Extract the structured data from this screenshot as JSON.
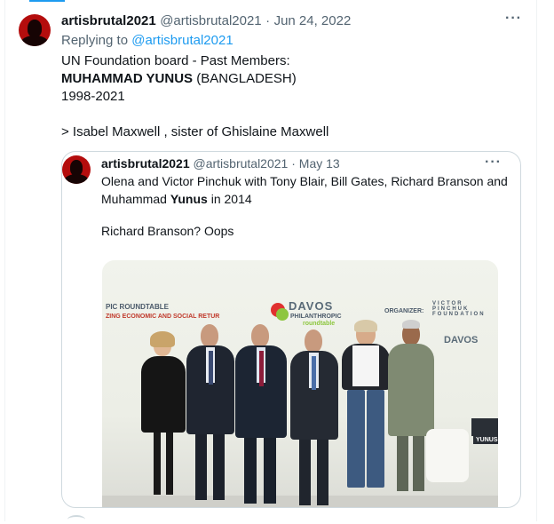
{
  "tweet": {
    "display_name": "artisbrutal2021",
    "handle": "@artisbrutal2021",
    "separator": "·",
    "date": "Jun 24, 2022",
    "replying_prefix": "Replying to",
    "replying_handle": "@artisbrutal2021",
    "more_icon": "more-horizontal-icon",
    "lines": {
      "line1": "UN Foundation board - Past Members:",
      "line2_bold": "MUHAMMAD YUNUS",
      "line2_rest": " (BANGLADESH)",
      "line3": "1998-2021",
      "line5": "> Isabel Maxwell , sister of Ghislaine Maxwell"
    }
  },
  "quote": {
    "display_name": "artisbrutal2021",
    "handle": "@artisbrutal2021",
    "separator": "·",
    "date": "May 13",
    "text_part1": "Olena and Victor Pinchuk with Tony Blair, Bill Gates, Richard Branson and Muhammad ",
    "text_bold": "Yunus",
    "text_part2": " in 2014",
    "text_line2": "Richard Branson? Oops",
    "photo": {
      "sign_left1": "PIC ROUNDTABLE",
      "sign_left2": "ZING ECONOMIC AND SOCIAL RETUR",
      "davos": "DAVOS",
      "philanthropic": "PHILANTHROPIC",
      "roundtable": "roundtable",
      "organizer": "ORGANIZER:",
      "foundation": "VICTOR PINCHUK FOUNDATION",
      "davos_right": "DAVOS",
      "yunus_card": "YUNUS"
    }
  },
  "colors": {
    "accent": "#1d9bf0",
    "text": "#0f1419",
    "muted": "#536471",
    "border": "#cfd9de",
    "avatar": "#b40d0d"
  }
}
